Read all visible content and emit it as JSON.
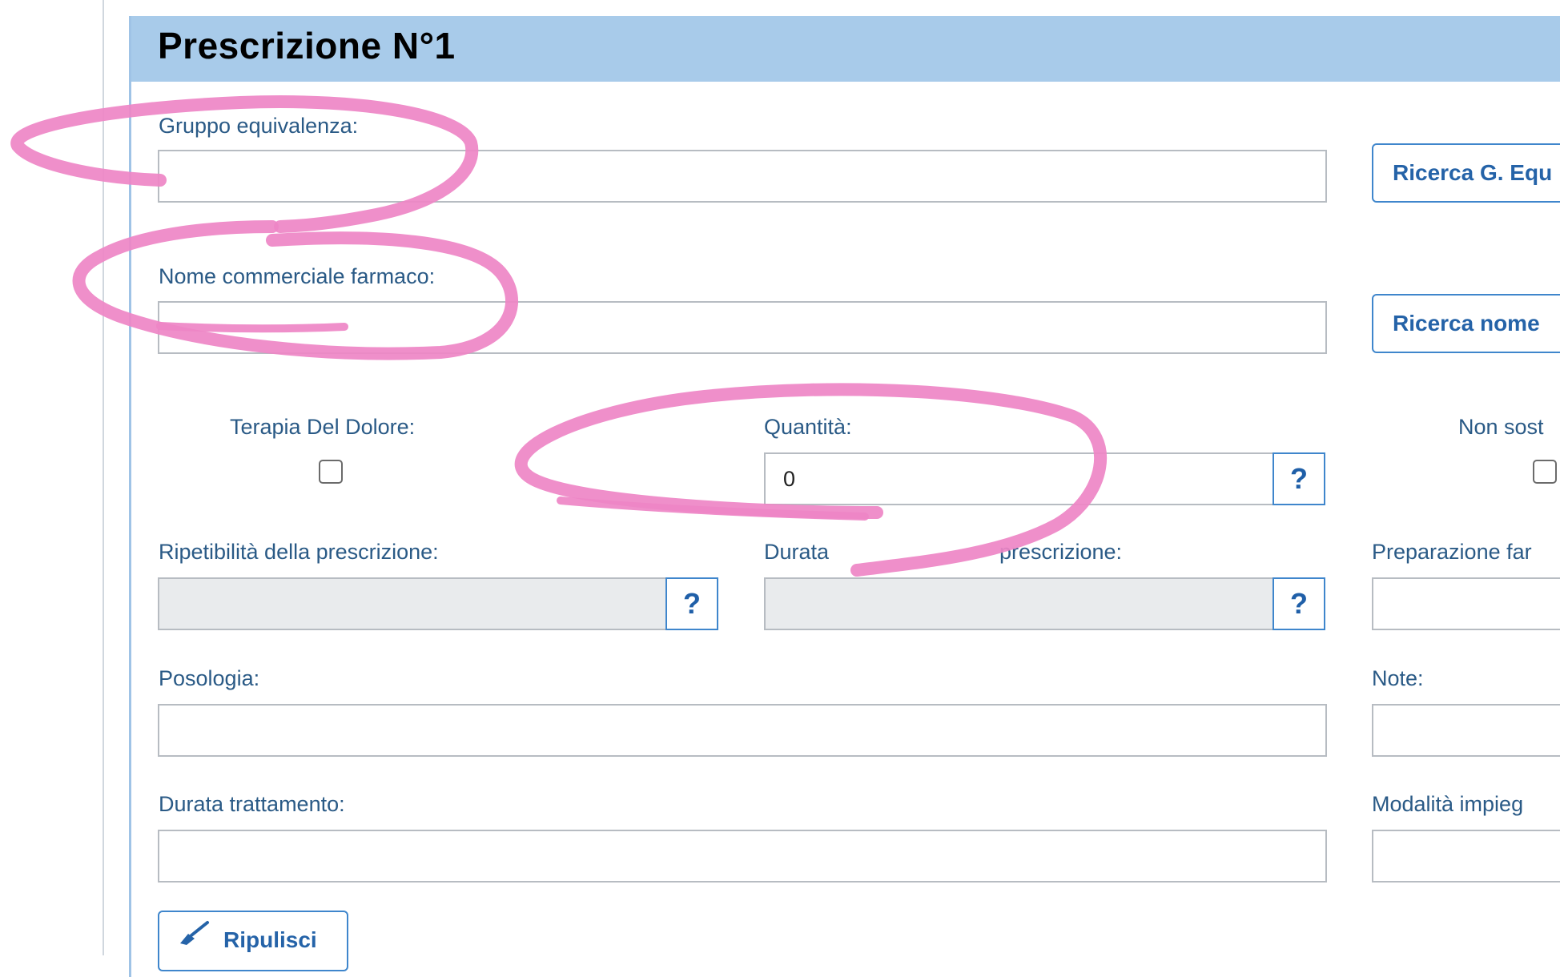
{
  "header": {
    "title": "Prescrizione N°1"
  },
  "fields": {
    "gruppo_equivalenza": {
      "label": "Gruppo equivalenza:",
      "value": ""
    },
    "nome_commerciale": {
      "label": "Nome commerciale farmaco:",
      "value": ""
    },
    "terapia_dolore": {
      "label": "Terapia Del Dolore:"
    },
    "quantita": {
      "label": "Quantità:",
      "value": "0"
    },
    "non_sost": {
      "label": "Non sost"
    },
    "ripetibilita": {
      "label": "Ripetibilità della prescrizione:",
      "value": ""
    },
    "durata_validita": {
      "label_left": "Durata",
      "label_right": "prescrizione:",
      "value": ""
    },
    "preparazione": {
      "label": "Preparazione far"
    },
    "posologia": {
      "label": "Posologia:",
      "value": ""
    },
    "note": {
      "label": "Note:"
    },
    "durata_trattamento": {
      "label": "Durata trattamento:",
      "value": ""
    },
    "modalita": {
      "label": "Modalità impieg"
    }
  },
  "buttons": {
    "ricerca_g_equ": "Ricerca G. Equ",
    "ricerca_nome": "Ricerca nome",
    "help": "?",
    "ripulisci": "Ripulisci"
  },
  "icons": {
    "help": "question-mark-icon",
    "broom": "broom-icon"
  },
  "colors": {
    "header_bg": "#a8cbea",
    "label_text": "#2a5a86",
    "button_border": "#3f86cc",
    "annotation": "#ee86c6"
  }
}
